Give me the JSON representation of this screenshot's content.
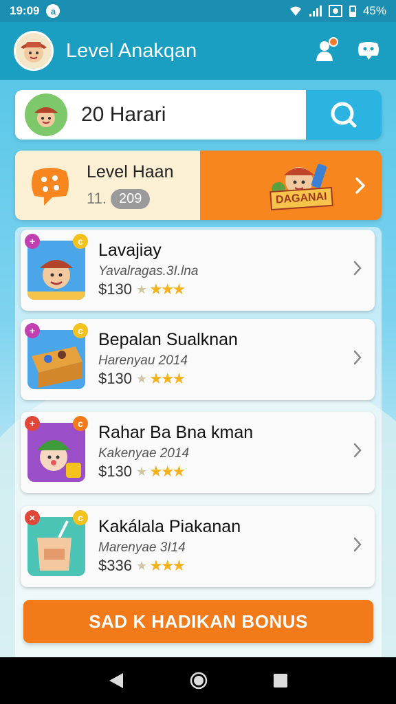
{
  "status_bar": {
    "time": "19:09",
    "notification_badge": "a",
    "battery": "45%"
  },
  "header": {
    "title": "Level Anakqan"
  },
  "search": {
    "value": "20 Harari"
  },
  "banner": {
    "title": "Level Haan",
    "count_prefix": "11.",
    "count_pill": "209",
    "badge_text": "DAGANAI"
  },
  "levels": [
    {
      "name": "Lavajiay",
      "subtitle": "Yavalragas.3I.lna",
      "price": "$130",
      "rating": 3
    },
    {
      "name": "Bepalan Sualknan",
      "subtitle": "Harenyau 2014",
      "price": "$130",
      "rating": 3
    },
    {
      "name": "Rahar Ba Bna kman",
      "subtitle": "Kakenyae 2014",
      "price": "$130",
      "rating": 3
    },
    {
      "name": "Kakálala Piakanan",
      "subtitle": "Marenyae 3I14",
      "price": "$336",
      "rating": 3
    }
  ],
  "cta": {
    "label": "SAD  K  HADIKAN BONUS"
  },
  "colors": {
    "header_bg": "#1a9ec2",
    "accent_orange": "#f27a18",
    "search_button": "#2bb4e2",
    "star": "#f4b21c"
  }
}
